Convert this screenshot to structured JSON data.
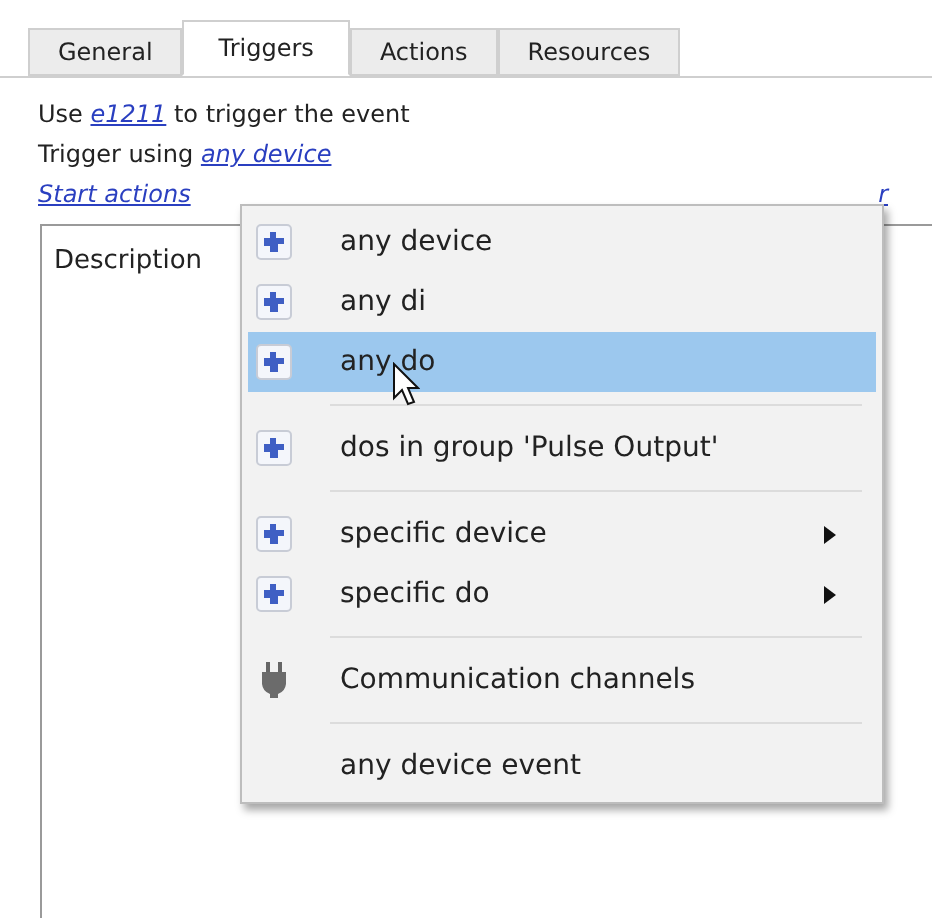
{
  "tabs": [
    {
      "label": "General",
      "selected": false
    },
    {
      "label": "Triggers",
      "selected": true
    },
    {
      "label": "Actions",
      "selected": false
    },
    {
      "label": "Resources",
      "selected": false
    }
  ],
  "lines": [
    {
      "before": "Use ",
      "link": "e1211",
      "after": " to trigger the event"
    },
    {
      "before": "Trigger using ",
      "link": "any device"
    }
  ],
  "start_actions": {
    "link": "Start actions",
    "tail": "r"
  },
  "list": {
    "column_1": "Description"
  },
  "menu": [
    {
      "kind": "device",
      "label": "any device",
      "selected": false,
      "submenu": false
    },
    {
      "kind": "device",
      "label": "any di",
      "selected": false,
      "submenu": false
    },
    {
      "kind": "device",
      "label": "any do",
      "selected": true,
      "submenu": false
    },
    {
      "kind": "separator"
    },
    {
      "kind": "device",
      "label": "dos in group 'Pulse Output'",
      "selected": false,
      "submenu": false
    },
    {
      "kind": "separator"
    },
    {
      "kind": "device",
      "label": "specific device",
      "selected": false,
      "submenu": true
    },
    {
      "kind": "device",
      "label": "specific do",
      "selected": false,
      "submenu": true
    },
    {
      "kind": "separator"
    },
    {
      "kind": "channel",
      "label": "Communication channels",
      "selected": false,
      "submenu": false
    },
    {
      "kind": "separator"
    },
    {
      "kind": "plain",
      "label": "any device event",
      "selected": false,
      "submenu": false
    }
  ]
}
